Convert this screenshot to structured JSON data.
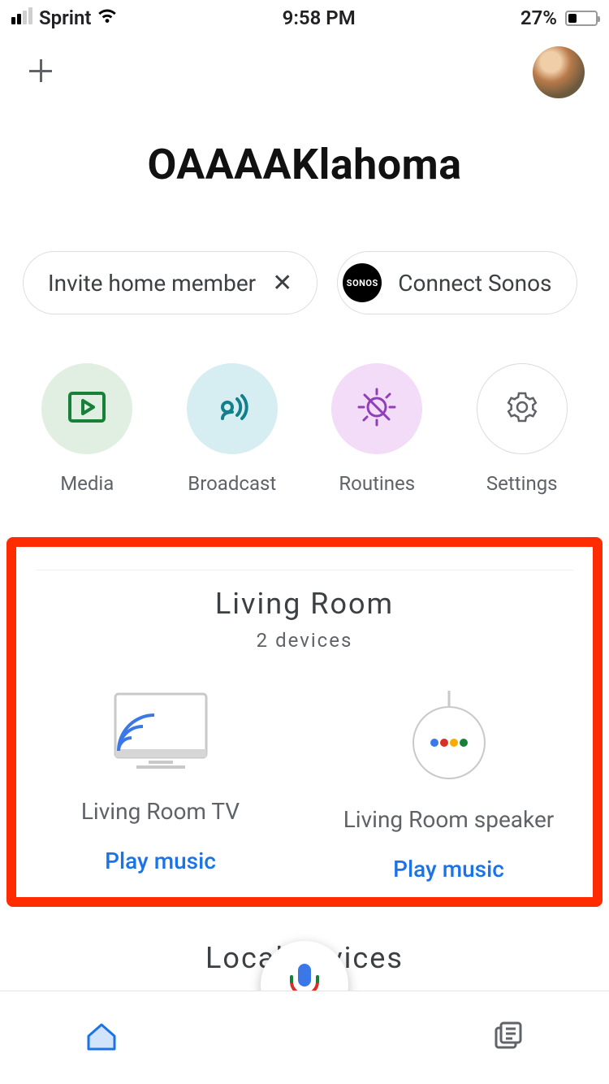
{
  "status": {
    "carrier": "Sprint",
    "time": "9:58 PM",
    "battery_pct": "27%"
  },
  "header": {
    "title": "OAAAAKlahoma"
  },
  "chips": {
    "invite": "Invite home member",
    "sonos_badge": "SONOS",
    "connect_sonos": "Connect Sonos"
  },
  "actions": {
    "media": "Media",
    "broadcast": "Broadcast",
    "routines": "Routines",
    "settings": "Settings"
  },
  "room": {
    "name": "Living Room",
    "device_count": "2 devices",
    "devices": [
      {
        "name": "Living Room TV",
        "action": "Play music"
      },
      {
        "name": "Living Room speaker",
        "action": "Play music"
      }
    ]
  },
  "local_heading": "Local devices",
  "colors": {
    "highlight": "#FE2C00",
    "link": "#1a73e8",
    "media_bg": "#e1efe3",
    "broadcast_bg": "#d6eef2",
    "routines_bg": "#f2dcf7",
    "media_fg": "#188038",
    "broadcast_fg": "#12808c",
    "routines_fg": "#8f3fb7"
  }
}
